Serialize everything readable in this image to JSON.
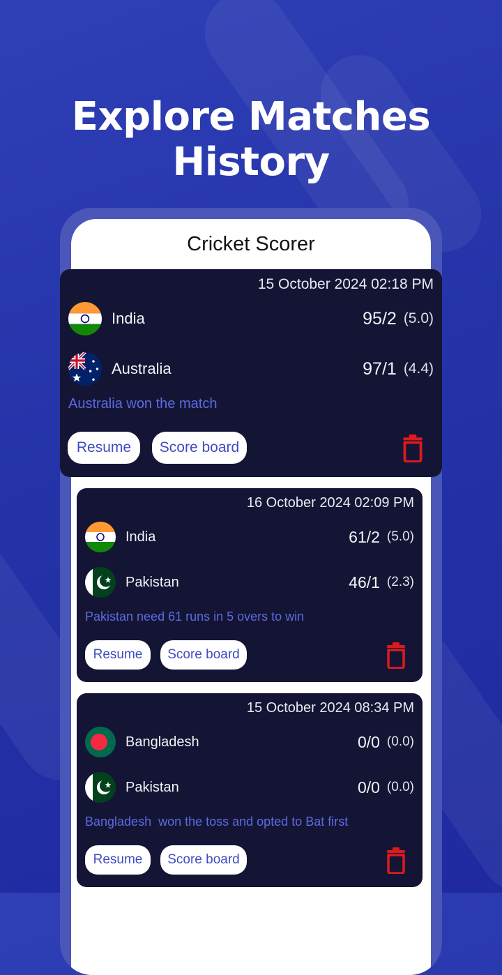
{
  "headline": "Explore Matches History",
  "app": {
    "title": "Cricket Scorer"
  },
  "matches": [
    {
      "date": "15 October 2024 02:18 PM",
      "team1": {
        "name": "India",
        "score": "95/2",
        "overs": "(5.0)",
        "flag": "india-flag"
      },
      "team2": {
        "name": "Australia",
        "score": "97/1",
        "overs": "(4.4)",
        "flag": "australia-flag"
      },
      "status": "Australia won the match",
      "resume_label": "Resume",
      "scoreboard_label": "Score board"
    },
    {
      "date": "16 October 2024 02:09 PM",
      "team1": {
        "name": "India",
        "score": "61/2",
        "overs": "(5.0)",
        "flag": "india-flag"
      },
      "team2": {
        "name": "Pakistan",
        "score": "46/1",
        "overs": "(2.3)",
        "flag": "pakistan-flag"
      },
      "status": "Pakistan need 61 runs in 5 overs to win",
      "resume_label": "Resume",
      "scoreboard_label": "Score board"
    },
    {
      "date": "15 October 2024 08:34 PM",
      "team1": {
        "name": "Bangladesh",
        "score": "0/0",
        "overs": "(0.0)",
        "flag": "bangladesh-flag"
      },
      "team2": {
        "name": "Pakistan",
        "score": "0/0",
        "overs": "(0.0)",
        "flag": "pakistan-flag"
      },
      "status": "Bangladesh  won the toss and opted to Bat first",
      "resume_label": "Resume",
      "scoreboard_label": "Score board"
    }
  ],
  "colors": {
    "background": "#2433a8",
    "card": "#141535",
    "status_text": "#5d6ae0",
    "button_text": "#3f4dc4",
    "delete": "#e0191d"
  }
}
